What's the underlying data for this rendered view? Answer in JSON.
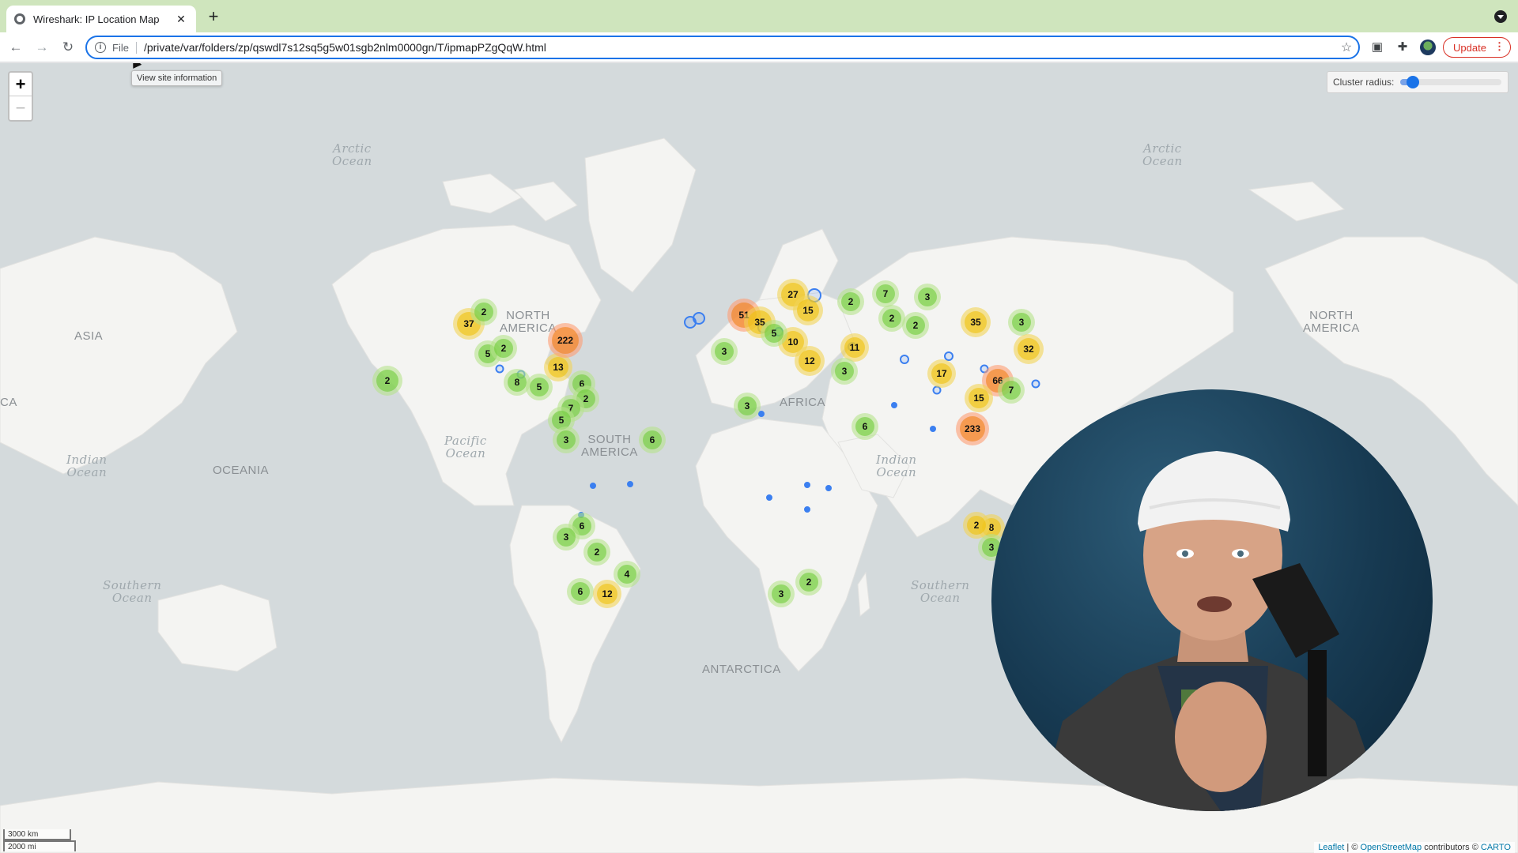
{
  "browser": {
    "tab_title": "Wireshark: IP Location Map",
    "tab_close": "✕",
    "new_tab": "+",
    "url_scheme": "File",
    "url": "/private/var/folders/zp/qswdl7s12sq5g5w01sgb2nlm0000gn/T/ipmapPZgQqW.html",
    "update_label": "Update",
    "update_menu": "⋮",
    "tooltip": "View site information",
    "icons": [
      "back-icon",
      "forward-icon",
      "reload-icon",
      "info-icon",
      "star-icon",
      "extension-icon",
      "puzzle-icon",
      "profile-avatar"
    ]
  },
  "map": {
    "zoom_in": "+",
    "zoom_out": "−",
    "cluster_radius_label": "Cluster radius:",
    "cluster_radius_level": 0.12,
    "scale_km": "3000 km",
    "scale_mi": "2000 mi",
    "attribution": {
      "leaflet": "Leaflet",
      "sep": " | © ",
      "osm": "OpenStreetMap",
      "mid": " contributors © ",
      "carto": "CARTO"
    },
    "ocean_labels": [
      {
        "id": "arctic-ocean-left",
        "text": "Arctic\nOcean"
      },
      {
        "id": "arctic-ocean-right",
        "text": "Arctic\nOcean"
      },
      {
        "id": "pacific-ocean",
        "text": "Pacific\nOcean"
      },
      {
        "id": "indian-ocean-left",
        "text": "Indian\nOcean"
      },
      {
        "id": "indian-ocean-right",
        "text": "Indian\nOcean"
      },
      {
        "id": "southern-ocean-left",
        "text": "Southern\nOcean"
      },
      {
        "id": "southern-ocean-right",
        "text": "Southern\nOcean"
      }
    ],
    "land_labels": [
      {
        "id": "asia",
        "text": "ASIA"
      },
      {
        "id": "oceania",
        "text": "OCEANIA"
      },
      {
        "id": "north-america-left",
        "text": "NORTH\nAMERICA"
      },
      {
        "id": "south-america",
        "text": "SOUTH\nAMERICA"
      },
      {
        "id": "africa",
        "text": "AFRICA"
      },
      {
        "id": "north-america-right",
        "text": "NORTH\nAMERICA"
      },
      {
        "id": "antarctica",
        "text": "ANTARCTICA"
      },
      {
        "id": "ca-edge",
        "text": "CA"
      }
    ],
    "cluster_counts": [
      "2",
      "37",
      "2",
      "5",
      "2",
      "8",
      "5",
      "6",
      "2",
      "7",
      "5",
      "3",
      "13",
      "222",
      "6",
      "6",
      "2",
      "4",
      "12",
      "6",
      "3",
      "51",
      "35",
      "27",
      "15",
      "10",
      "5",
      "3",
      "12",
      "11",
      "3",
      "2",
      "7",
      "3",
      "2",
      "2",
      "3",
      "6",
      "3",
      "2",
      "17",
      "35",
      "3",
      "32",
      "66",
      "15",
      "7",
      "233",
      "8",
      "3",
      "2"
    ]
  }
}
